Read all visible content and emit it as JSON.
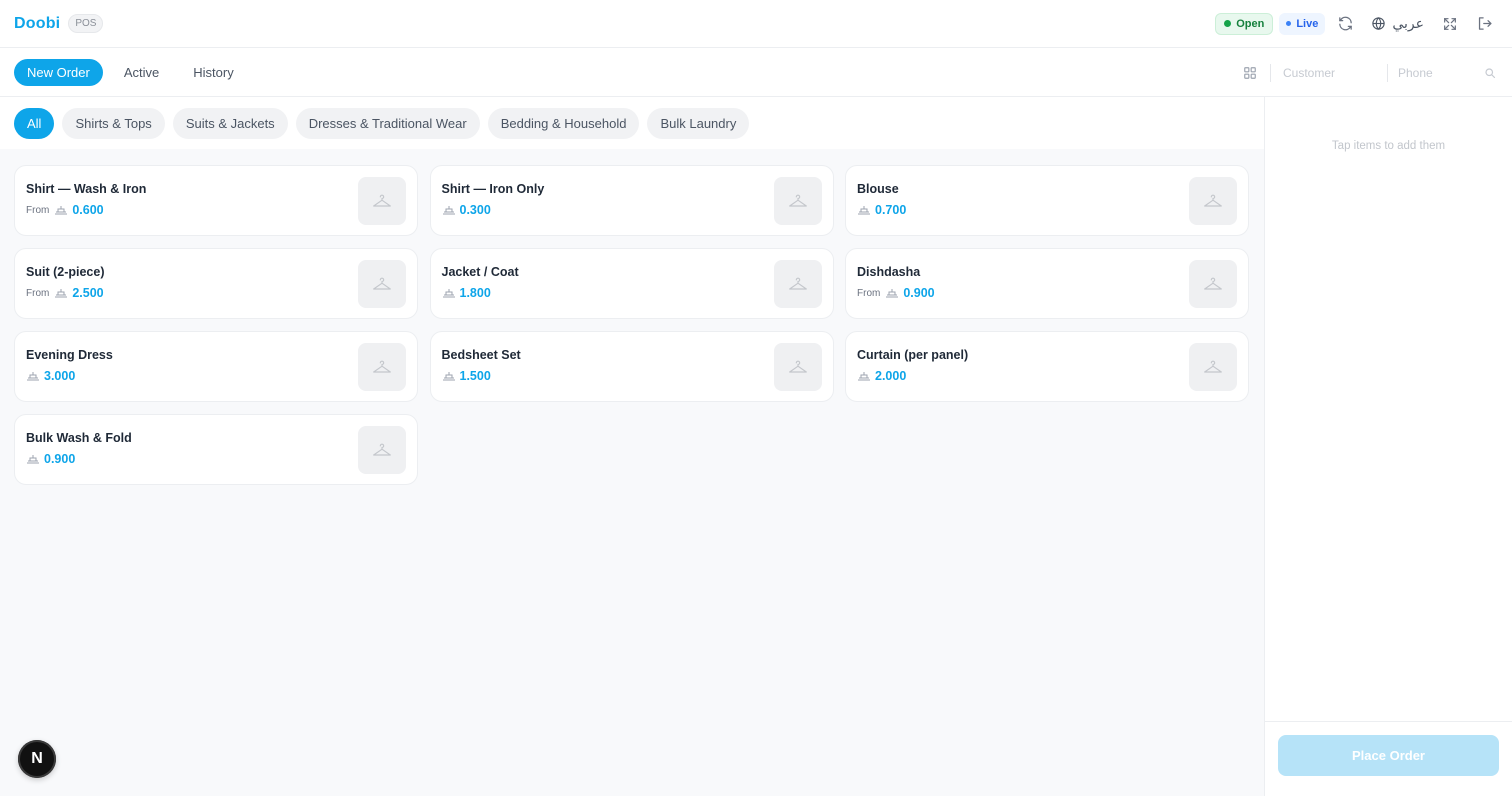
{
  "app": {
    "title": "Doobi",
    "badge": "POS"
  },
  "status": {
    "open": "Open",
    "live": "Live"
  },
  "header_icons": [
    "refresh-icon",
    "globe-icon",
    "fullscreen-icon",
    "logout-icon"
  ],
  "language": {
    "label": "عربي"
  },
  "tabs": [
    {
      "label": "New Order",
      "active": true
    },
    {
      "label": "Active",
      "active": false
    },
    {
      "label": "History",
      "active": false
    }
  ],
  "customer": {
    "customer_placeholder": "Customer",
    "phone_placeholder": "Phone"
  },
  "categories": [
    {
      "label": "All",
      "active": true
    },
    {
      "label": "Shirts & Tops",
      "active": false
    },
    {
      "label": "Suits & Jackets",
      "active": false
    },
    {
      "label": "Dresses & Traditional Wear",
      "active": false
    },
    {
      "label": "Bedding & Household",
      "active": false
    },
    {
      "label": "Bulk Laundry",
      "active": false
    }
  ],
  "items": [
    {
      "name": "Shirt — Wash & Iron",
      "from": "From",
      "price": "0.600"
    },
    {
      "name": "Shirt — Iron Only",
      "from": "",
      "price": "0.300"
    },
    {
      "name": "Blouse",
      "from": "",
      "price": "0.700"
    },
    {
      "name": "Suit (2-piece)",
      "from": "From",
      "price": "2.500"
    },
    {
      "name": "Jacket / Coat",
      "from": "",
      "price": "1.800"
    },
    {
      "name": "Dishdasha",
      "from": "From",
      "price": "0.900"
    },
    {
      "name": "Evening Dress",
      "from": "",
      "price": "3.000"
    },
    {
      "name": "Bedsheet Set",
      "from": "",
      "price": "1.500"
    },
    {
      "name": "Curtain (per panel)",
      "from": "",
      "price": "2.000"
    },
    {
      "name": "Bulk Wash & Fold",
      "from": "",
      "price": "0.900"
    }
  ],
  "cart": {
    "empty_message": "Tap items to add them",
    "place_order": "Place Order"
  },
  "fab": {
    "label": "N"
  },
  "colors": {
    "accent": "#0ea5e9",
    "open": "#16a34a",
    "live": "#3b82f6"
  }
}
